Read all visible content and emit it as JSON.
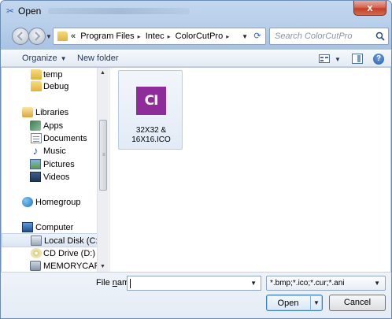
{
  "window": {
    "title": "Open",
    "title_icon": "scissors-icon",
    "close_symbol": "x"
  },
  "address": {
    "overflow_marker": "«",
    "crumbs": [
      "Program Files",
      "Intec",
      "ColorCutPro"
    ],
    "separator": "▸"
  },
  "search": {
    "placeholder": "Search ColorCutPro"
  },
  "toolbar": {
    "organize_label": "Organize",
    "new_folder_label": "New folder",
    "help_symbol": "?"
  },
  "nav": {
    "items": [
      {
        "label": "temp",
        "icon": "folder-icon"
      },
      {
        "label": "Debug",
        "icon": "folder-icon"
      },
      {
        "label": "Libraries",
        "icon": "libraries-icon"
      },
      {
        "label": "Apps",
        "icon": "apps-icon"
      },
      {
        "label": "Documents",
        "icon": "documents-icon"
      },
      {
        "label": "Music",
        "icon": "music-icon"
      },
      {
        "label": "Pictures",
        "icon": "pictures-icon"
      },
      {
        "label": "Videos",
        "icon": "videos-icon"
      },
      {
        "label": "Homegroup",
        "icon": "homegroup-icon"
      },
      {
        "label": "Computer",
        "icon": "computer-icon"
      },
      {
        "label": "Local Disk (C:)",
        "icon": "local-disk-icon",
        "selected": true
      },
      {
        "label": "CD Drive (D:)",
        "icon": "cd-drive-icon"
      },
      {
        "label": "MEMORYCARD (",
        "icon": "memory-card-icon"
      }
    ]
  },
  "files": [
    {
      "name": "32X32 & 16X16.ICO",
      "thumb_text": "CI",
      "thumb_color": "#8e2d9a"
    }
  ],
  "bottom": {
    "file_name_label_prefix": "File ",
    "file_name_label_accel": "n",
    "file_name_label_suffix": "ame:",
    "file_name_value": "",
    "filter_value": "*.bmp;*.ico;*.cur;*.ani",
    "open_label": "Open",
    "cancel_label": "Cancel"
  }
}
